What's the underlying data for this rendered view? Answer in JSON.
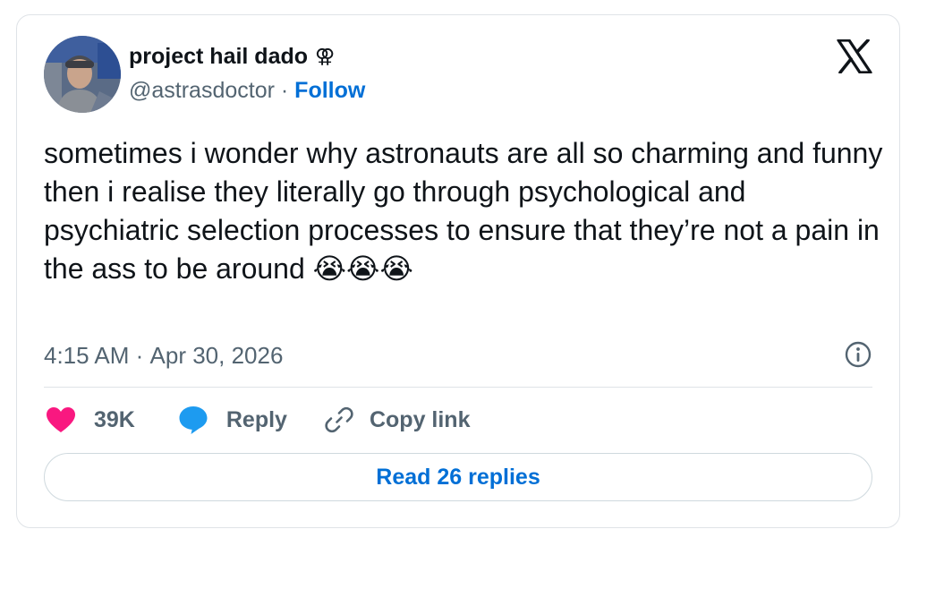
{
  "tweet": {
    "display_name": "project hail dado",
    "name_symbol": "⚢",
    "handle": "@astrasdoctor",
    "separator": " · ",
    "follow_label": "Follow",
    "text": "sometimes i wonder why astronauts are all so charming and funny then i realise they literally go through psychological and psychiatric selection processes to ensure that they’re not a pain in the ass to be around 😭😭😭",
    "time": "4:15 AM",
    "date_separator": " · ",
    "date": "Apr 30, 2026"
  },
  "actions": {
    "like_count": "39K",
    "reply_label": "Reply",
    "copy_link_label": "Copy link"
  },
  "footer": {
    "read_replies_label": "Read 26 replies"
  },
  "icons": {
    "logo": "x-logo-icon",
    "info": "info-icon",
    "like": "heart-icon",
    "reply": "speech-bubble-icon",
    "copy": "link-icon"
  },
  "colors": {
    "link_blue": "#006fd6",
    "heart_pink": "#f91880",
    "reply_blue": "#1d9bf0",
    "muted_gray": "#536471",
    "text_black": "#0f1419",
    "border": "#dfe3e7"
  }
}
